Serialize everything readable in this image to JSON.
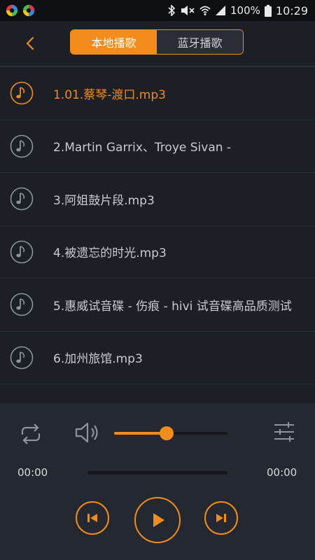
{
  "status_bar": {
    "battery": "100%",
    "time": "10:29",
    "icons": [
      "app-icon-1",
      "app-icon-2",
      "bluetooth-icon",
      "mute-icon",
      "wifi-icon",
      "signal-icon",
      "battery-icon"
    ]
  },
  "header": {
    "back_icon": "chevron-left-icon",
    "tabs": [
      {
        "label": "本地播歌",
        "active": true
      },
      {
        "label": "蓝牙播歌",
        "active": false
      }
    ]
  },
  "playlist": {
    "items": [
      {
        "title": "1.01.蔡琴-渡口.mp3",
        "active": true
      },
      {
        "title": "2.Martin Garrix、Troye Sivan -",
        "active": false
      },
      {
        "title": "3.阿姐鼓片段.mp3",
        "active": false
      },
      {
        "title": "4.被遗忘的时光.mp3",
        "active": false
      },
      {
        "title": "5.惠威试音碟 - 伤痕 - hivi 试音碟高品质测试",
        "active": false
      },
      {
        "title": "6.加州旅馆.mp3",
        "active": false
      }
    ]
  },
  "player": {
    "volume_fraction": 0.46,
    "current_time": "00:00",
    "total_time": "00:00",
    "progress_fraction": 0,
    "icons": [
      "repeat-icon",
      "volume-icon",
      "equalizer-icon",
      "previous-icon",
      "play-icon",
      "next-icon"
    ]
  },
  "colors": {
    "accent": "#f28c1c",
    "background": "#1c1f26",
    "player_background": "#242831"
  }
}
